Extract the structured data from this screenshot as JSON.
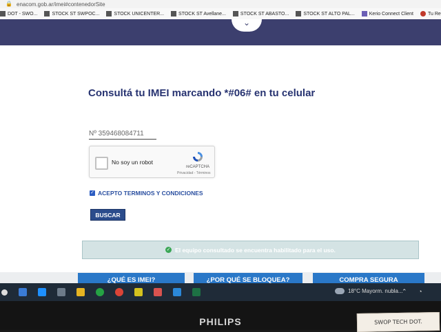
{
  "browser": {
    "url": "enacom.gob.ar/imei#contenedorSite",
    "bookmarks": [
      {
        "label": "DOT - SWO...",
        "icon": "bookmark-icon"
      },
      {
        "label": "STOCK ST SWPOC...",
        "icon": "bookmark-icon"
      },
      {
        "label": "STOCK UNICENTER...",
        "icon": "bookmark-icon"
      },
      {
        "label": "STOCK ST Avellane...",
        "icon": "bookmark-icon"
      },
      {
        "label": "STOCK ST ABASTO...",
        "icon": "bookmark-icon"
      },
      {
        "label": "STOCK ST ALTO PAL...",
        "icon": "bookmark-icon"
      },
      {
        "label": "Kerio Connect Client",
        "icon": "kerio-icon"
      },
      {
        "label": "Tu Re",
        "icon": "bookmark-icon"
      }
    ]
  },
  "page": {
    "title": "Consultá tu IMEI marcando *#06# en tu celular",
    "imei_value": "Nº 359468084711",
    "recaptcha": {
      "label": "No soy un robot",
      "brand": "reCAPTCHA",
      "terms": "Privacidad - Términos"
    },
    "accept_label": "ACEPTO TERMINOS Y CONDICIONES",
    "search_button": "BUSCAR",
    "alert_text": "El equipo consultado se encuentra habilitado para el uso.",
    "bottom_buttons": [
      "¿QUÉ ES IMEI?",
      "¿POR QUÉ SE BLOQUEA?",
      "COMPRA SEGURA"
    ]
  },
  "taskbar": {
    "weather": "18°C  Mayorm. nubla..."
  },
  "monitor": {
    "brand": "PHILIPS",
    "sticker": "SWOP TECH DOT."
  },
  "colors": {
    "header": "#3c3f6e",
    "title": "#273371",
    "button": "#2b4c8c",
    "alert_bg": "#d4e3e4",
    "bottom_button": "#2a78c8"
  }
}
